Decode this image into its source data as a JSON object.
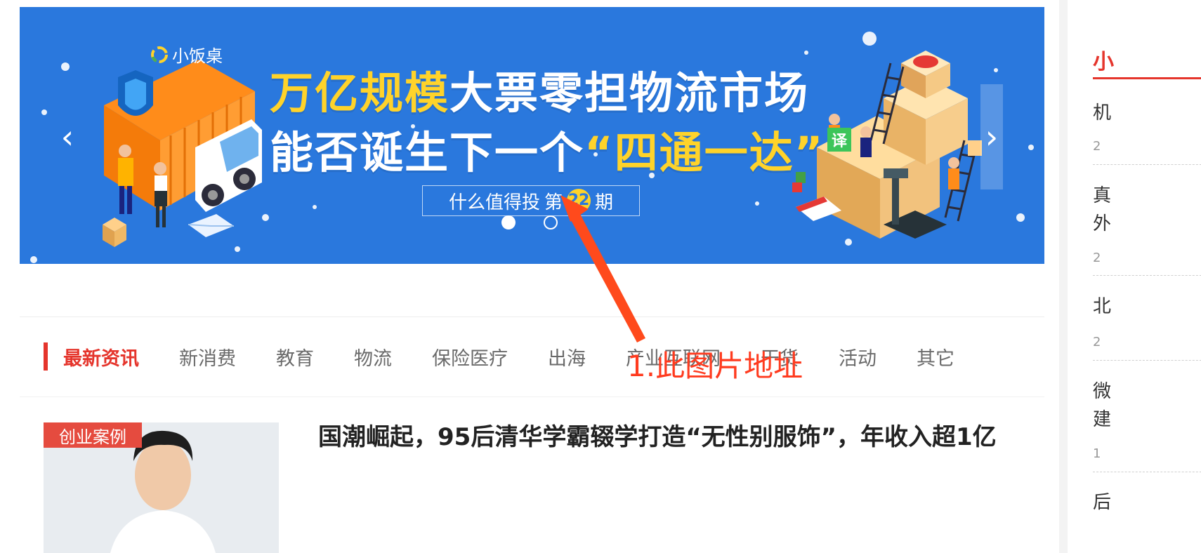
{
  "banner": {
    "brand": "小饭桌",
    "headline_line1_yellow": "万亿规模",
    "headline_line1_white": "大票零担物流市场",
    "headline_line2_white": "能否诞生下一个",
    "headline_line2_yellow": "“四通一达”",
    "issue_prefix": "什么值得投",
    "issue_di": "第",
    "issue_number": "22",
    "issue_suffix": "期",
    "prev_arrow": "‹",
    "next_arrow": "›",
    "translate_badge": "译",
    "colors": {
      "background": "#2a78dd",
      "accent_yellow": "#ffd32a"
    }
  },
  "categories": {
    "items": [
      "最新资讯",
      "新消费",
      "教育",
      "物流",
      "保险医疗",
      "出海",
      "产业互联网",
      "干货",
      "活动",
      "其它"
    ],
    "active_index": 0,
    "accent_color": "#e5352c"
  },
  "annotation": {
    "label": "1.此图片地址",
    "color": "#ff3b1f"
  },
  "article": {
    "tag": "创业案例",
    "title": "国潮崛起，95后清华学霸辍学打造“无性别服饰”，年收入超1亿"
  },
  "sidebar": {
    "title": "小",
    "rows": [
      {
        "text": "机",
        "date": "2"
      },
      {
        "text": "真",
        "text2": "外",
        "date": "2"
      },
      {
        "text": "北",
        "date": "2"
      },
      {
        "text": "微",
        "text2": "建",
        "date": "1"
      },
      {
        "text": "后"
      }
    ]
  }
}
